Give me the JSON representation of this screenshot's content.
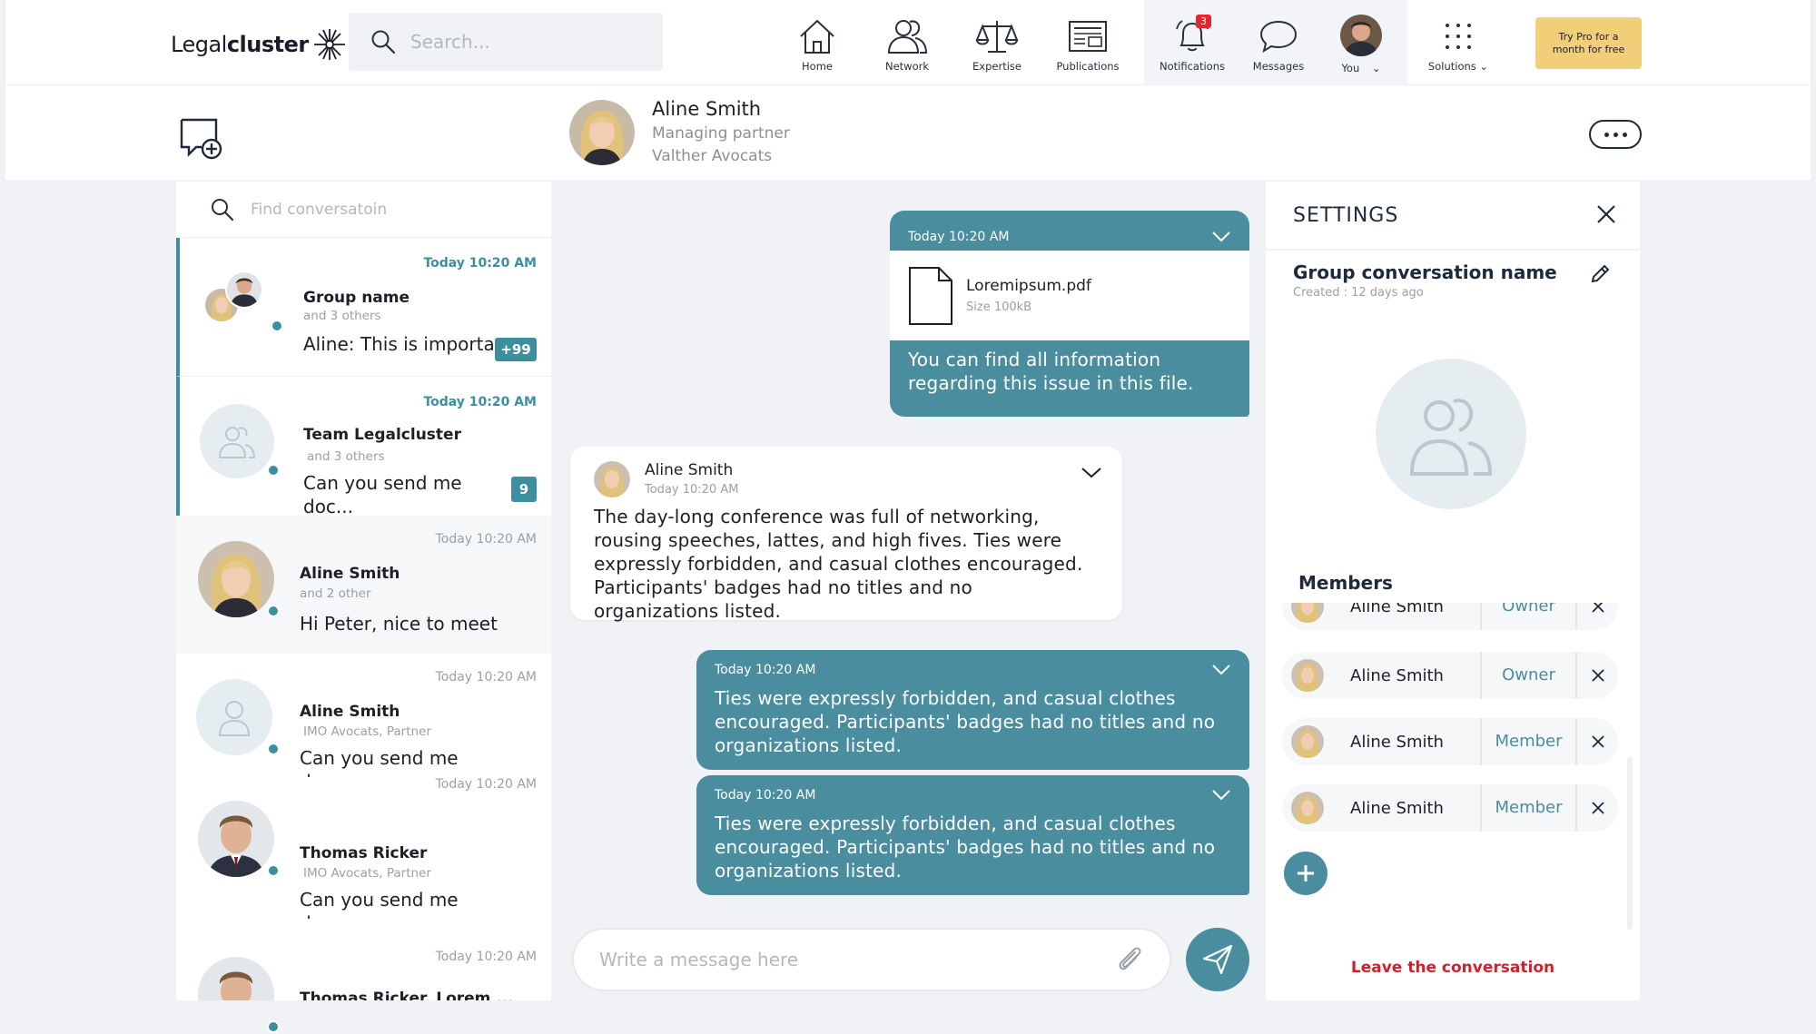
{
  "brand": {
    "logo_light": "Legal",
    "logo_bold": "cluster"
  },
  "search": {
    "placeholder": "Search..."
  },
  "nav": {
    "items": [
      {
        "label": "Home",
        "icon": "home-icon"
      },
      {
        "label": "Network",
        "icon": "network-icon"
      },
      {
        "label": "Expertise",
        "icon": "scales-icon"
      },
      {
        "label": "Publications",
        "icon": "newspaper-icon"
      },
      {
        "label": "Notifications",
        "icon": "bell-icon",
        "count": "3"
      },
      {
        "label": "Messages",
        "icon": "chat-bubble-icon"
      },
      {
        "label": "You",
        "icon": "avatar"
      },
      {
        "label": "Solutions",
        "icon": "grid-dots-icon"
      }
    ],
    "pro_button": "Try Pro for a month for free"
  },
  "contact": {
    "name": "Aline Smith",
    "title": "Managing partner",
    "company": "Valther Avocats"
  },
  "conversations": {
    "search_placeholder": "Find conversatoin",
    "items": [
      {
        "time": "Today 10:20 AM",
        "name": "Group name",
        "sub": "and 3 others",
        "message": "Aline: This is importa...",
        "badge": "+99"
      },
      {
        "time": "Today 10:20 AM",
        "name": "Team Legalcluster",
        "sub": "and 3 others",
        "message": "Can you send me doc...",
        "badge": "9"
      },
      {
        "time": "Today 10:20 AM",
        "name": "Aline Smith",
        "sub": "and 2 other",
        "message": "Hi Peter, nice to meet ..."
      },
      {
        "time": "Today 10:20 AM",
        "name": "Aline Smith",
        "sub": "IMO Avocats, Partner",
        "message": "Can you send me doc..."
      },
      {
        "time": "Today 10:20 AM",
        "name": "Thomas Ricker",
        "sub": "IMO Avocats, Partner",
        "message": "Can you send me doc..."
      },
      {
        "time": "Today 10:20 AM",
        "name": "Thomas Ricker, Lorem ..."
      }
    ]
  },
  "chat": {
    "messages": [
      {
        "time": "Today 10:20 AM",
        "file_name": "Loremipsum.pdf",
        "file_size": "Size 100kB",
        "text": "You can find all information regarding this issue in this file."
      },
      {
        "sender": "Aline Smith",
        "time": "Today 10:20 AM",
        "text": "The day-long conference was full of networking, rousing speeches, lattes, and high fives. Ties were expressly forbidden, and casual clothes encouraged. Participants' badges had no titles and no organizations listed."
      },
      {
        "time": "Today 10:20 AM",
        "text": "Ties were expressly forbidden, and casual clothes encouraged. Participants' badges had no titles and no organizations listed."
      },
      {
        "time": "Today 10:20 AM",
        "text": "Ties were expressly forbidden, and casual clothes encouraged. Participants' badges had no titles and no organizations listed."
      }
    ],
    "composer_placeholder": "Write a message here"
  },
  "settings": {
    "title": "SETTINGS",
    "group_name": "Group conversation name",
    "created": "Created : 12 days ago",
    "members_label": "Members",
    "members": [
      {
        "name": "Aline Smith",
        "role": "Owner"
      },
      {
        "name": "Aline Smith",
        "role": "Owner"
      },
      {
        "name": "Aline Smith",
        "role": "Member"
      },
      {
        "name": "Aline Smith",
        "role": "Member"
      }
    ],
    "leave": "Leave the conversation"
  },
  "colors": {
    "accent": "#4a8d9f",
    "leave": "#d0222b",
    "pro": "#f1ce78",
    "notification": "#e3262e"
  }
}
